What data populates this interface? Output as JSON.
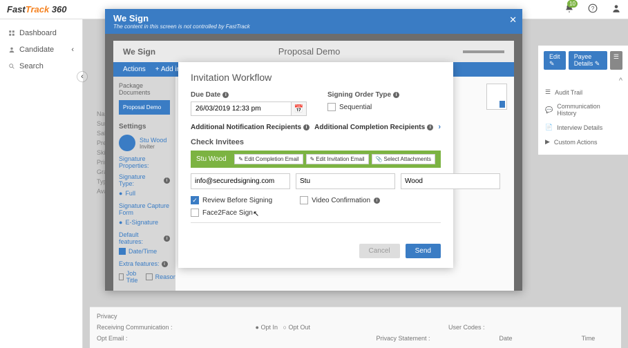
{
  "logo": {
    "fast": "Fast",
    "track": "Track",
    "suffix": "360"
  },
  "topbar": {
    "badge_count": "10"
  },
  "sidebar": {
    "items": [
      {
        "label": "Dashboard"
      },
      {
        "label": "Candidate"
      },
      {
        "label": "Search"
      }
    ]
  },
  "right_panel": {
    "edit_btn": "Edit",
    "payee_btn": "Payee Details",
    "menu": [
      {
        "label": "Audit Trail"
      },
      {
        "label": "Communication History"
      },
      {
        "label": "Interview Details"
      },
      {
        "label": "Custom Actions"
      }
    ]
  },
  "bg_labels": [
    "Name :",
    "Surname :",
    "Salutation :",
    "Pref./M",
    "Skill Group",
    "Primary",
    "Grade",
    "Type :",
    "Avail To :"
  ],
  "privacy": {
    "header": "Privacy",
    "row1": {
      "l1": "Receiving Communication :",
      "opt_in": "Opt In",
      "opt_out": "Opt Out",
      "user_codes": "User Codes :"
    },
    "row2": {
      "l1": "Opt Email :",
      "privacy_statement": "Privacy Statement :",
      "date": "Date",
      "time": "Time"
    }
  },
  "modal_outer": {
    "title": "We Sign",
    "subtext": "The content in this screen is not controlled by FastTrack"
  },
  "wesign": {
    "title": "We Sign",
    "doc": "Proposal Demo",
    "actions": "Actions",
    "add_invitee": "+ Add invitee",
    "left_panel": {
      "pkg_hdr": "Package Documents",
      "pkg_item": "Proposal Demo",
      "settings": "Settings",
      "user": "Stu Wood",
      "user_role": "Inviter",
      "sig_props": "Signature Properties:",
      "sig_type": "Signature Type:",
      "full": "Full",
      "capture": "Signature Capture Form",
      "esig": "E-Signature",
      "def_feat": "Default features:",
      "datetime": "Date/Time",
      "extra": "Extra features:",
      "job_title": "Job Title",
      "reason": "Reason"
    }
  },
  "invitation": {
    "title": "Invitation Workflow",
    "due_date": "Due Date",
    "due_date_val": "26/03/2019 12:33 pm",
    "signing_order": "Signing Order Type",
    "sequential": "Sequential",
    "notif_recip": "Additional Notification Recipients",
    "compl_recip": "Additional Completion Recipients",
    "check_invitees": "Check Invitees",
    "invitee_name": "Stu Wood",
    "btn_edit_completion": "Edit Completion Email",
    "btn_edit_invitation": "Edit Invitation Email",
    "btn_select_attach": "Select Attachments",
    "email": "info@securedsigning.com",
    "fname": "Stu",
    "lname": "Wood",
    "review_before": "Review Before Signing",
    "video_conf": "Video Confirmation",
    "f2f": "Face2Face Sign",
    "cancel": "Cancel",
    "send": "Send"
  }
}
